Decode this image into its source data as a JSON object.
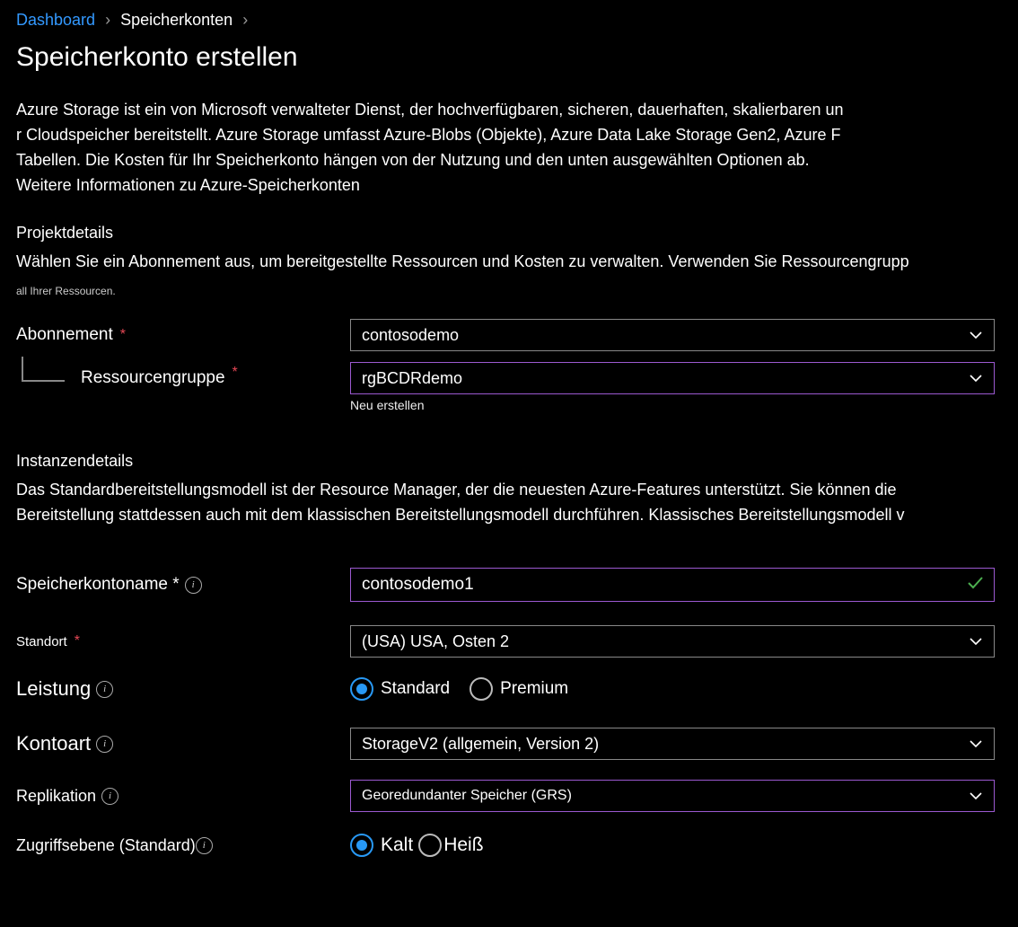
{
  "breadcrumb": {
    "dashboard": "Dashboard",
    "storage_accounts": "Speicherkonten"
  },
  "page_title": "Speicherkonto erstellen",
  "intro": {
    "line1": "Azure Storage ist ein von Microsoft verwalteter Dienst, der hochverfügbaren, sicheren, dauerhaften, skalierbaren un",
    "line2": "r Cloudspeicher bereitstellt. Azure Storage umfasst Azure-Blobs (Objekte), Azure Data Lake Storage Gen2, Azure F",
    "line3": "Tabellen. Die Kosten für Ihr Speicherkonto hängen von der Nutzung und den unten ausgewählten Optionen ab.",
    "link": "Weitere Informationen zu Azure-Speicherkonten"
  },
  "project": {
    "heading": "Projektdetails",
    "desc_big": "Wählen Sie ein Abonnement aus, um bereitgestellte Ressourcen und Kosten zu verwalten. Verwenden Sie Ressourcengrupp",
    "desc_small": "all Ihrer Ressourcen.",
    "subscription_label": "Abonnement",
    "subscription_value": "contosodemo",
    "rg_label": "Ressourcengruppe",
    "rg_value": "rgBCDRdemo",
    "new_link": "Neu erstellen"
  },
  "instance": {
    "heading": "Instanzendetails",
    "desc1": "Das Standardbereitstellungsmodell ist der Resource Manager, der die neuesten Azure-Features unterstützt. Sie können die",
    "desc2": "Bereitstellung stattdessen auch mit dem klassischen Bereitstellungsmodell durchführen. Klassisches Bereitstellungsmodell v",
    "name_label": "Speicherkontoname *",
    "name_value": "contosodemo1",
    "location_label": "Standort",
    "location_value": "(USA) USA, Osten 2",
    "performance_label": "Leistung",
    "perf_standard": "Standard",
    "perf_premium": "Premium",
    "account_kind_label": "Kontoart",
    "account_kind_value": "StorageV2 (allgemein, Version 2)",
    "replication_label": "Replikation",
    "replication_value": "Georedundanter Speicher (GRS)",
    "access_tier_label": "Zugriffsebene (Standard)",
    "tier_cold": "Kalt",
    "tier_hot": "Heiß"
  }
}
